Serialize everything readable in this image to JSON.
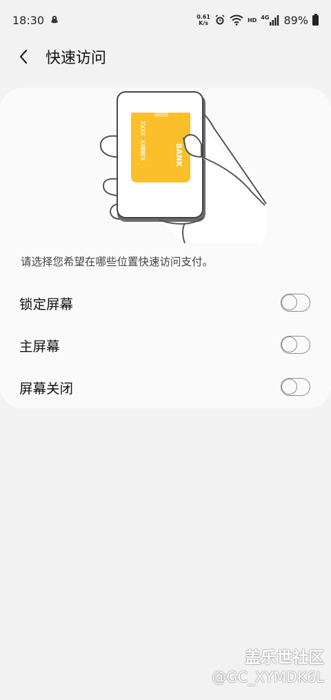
{
  "status_bar": {
    "time": "18:30",
    "net_speed_value": "0.61",
    "net_speed_unit": "K/s",
    "hd_label": "HD",
    "network_label": "4G",
    "battery_percent": "89%"
  },
  "app_bar": {
    "title": "快速访问"
  },
  "illustration": {
    "card_number_1": "XXXX XXXX",
    "card_number_2": "XXXX",
    "card_brand": "BANK"
  },
  "description": "请选择您希望在哪些位置快速访问支付。",
  "options": [
    {
      "label": "锁定屏幕",
      "enabled": false
    },
    {
      "label": "主屏幕",
      "enabled": false
    },
    {
      "label": "屏幕关闭",
      "enabled": false
    }
  ],
  "watermark": {
    "line1": "盖乐世社区",
    "line2": "@GC_XYMDK6L"
  },
  "colors": {
    "background": "#f2f2f2",
    "card": "#fafafa",
    "bank_card": "#fbbf2b",
    "toggle_border": "#8c8c8c"
  }
}
